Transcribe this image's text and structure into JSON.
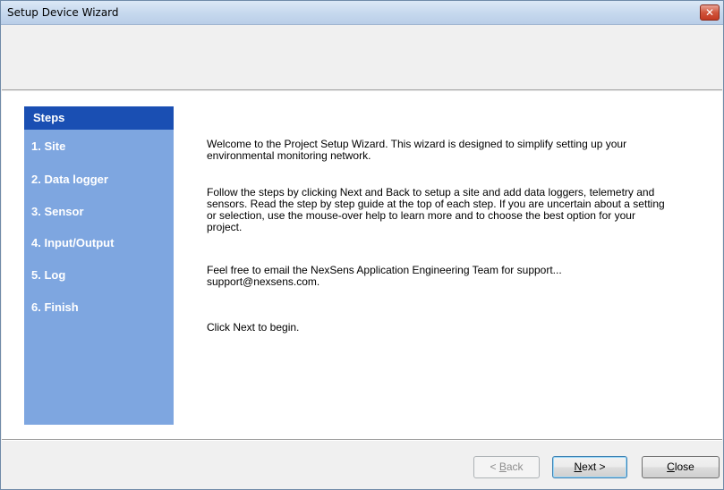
{
  "window": {
    "title": "Setup Device Wizard",
    "close_glyph": "✕"
  },
  "steps": {
    "header": "Steps",
    "items": [
      {
        "label": "1. Site"
      },
      {
        "label": "2. Data logger"
      },
      {
        "label": "3. Sensor"
      },
      {
        "label": "4. Input/Output"
      },
      {
        "label": "5. Log"
      },
      {
        "label": "6. Finish"
      }
    ]
  },
  "welcome": {
    "para1": "Welcome to the Project Setup Wizard. This wizard is designed to simplify setting up your environmental monitoring network.",
    "para2": "Follow the steps by clicking Next and Back to setup a site and add data loggers, telemetry and sensors. Read the step by step guide at the top of each step. If you are uncertain about a setting or selection, use the mouse-over help to learn more and to choose the best option for your project.",
    "para3_line1": "Feel free to email the NexSens Application Engineering Team for support...",
    "para3_line2": "support@nexsens.com.",
    "para4": "Click Next to begin."
  },
  "buttons": {
    "back_prefix": "< ",
    "back_mnemonic": "B",
    "back_rest": "ack",
    "next_mnemonic": "N",
    "next_rest": "ext >",
    "close_mnemonic": "C",
    "close_rest": "lose"
  },
  "colors": {
    "steps_panel": "#7ea6e0",
    "steps_header": "#1a4fb3"
  }
}
